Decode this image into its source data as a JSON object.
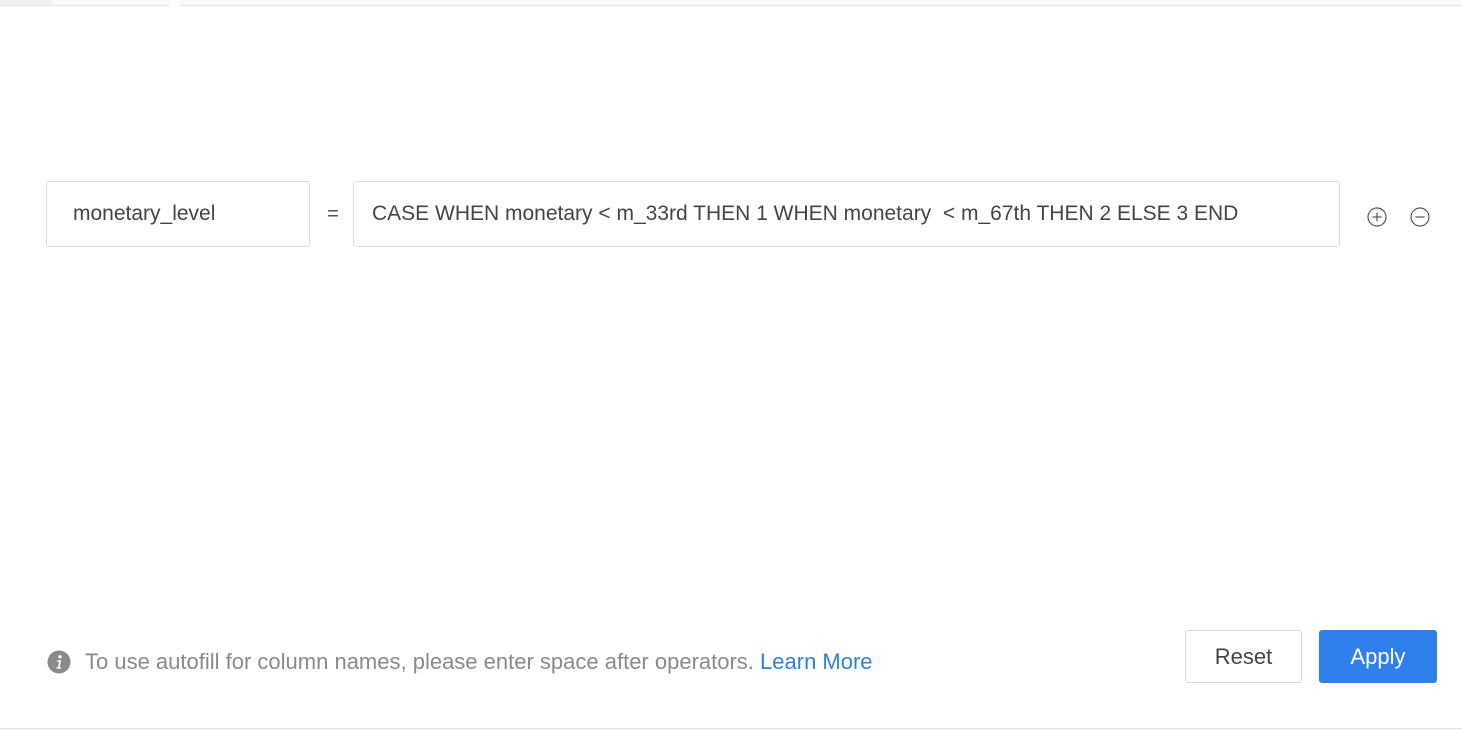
{
  "formula": {
    "column_name": "monetary_level",
    "equals": "=",
    "expression": "CASE WHEN monetary < m_33rd THEN 1 WHEN monetary  < m_67th THEN 2 ELSE 3 END"
  },
  "row_actions": {
    "add_icon": "circle-plus",
    "remove_icon": "circle-minus"
  },
  "footer": {
    "hint": "To use autofill for column names, please enter space after operators.",
    "learn_more": "Learn More",
    "reset_label": "Reset",
    "apply_label": "Apply"
  },
  "colors": {
    "accent": "#2f80ed",
    "link": "#2f7fe0",
    "hint_text": "#8a8a8a",
    "border": "#dcdcdc"
  }
}
